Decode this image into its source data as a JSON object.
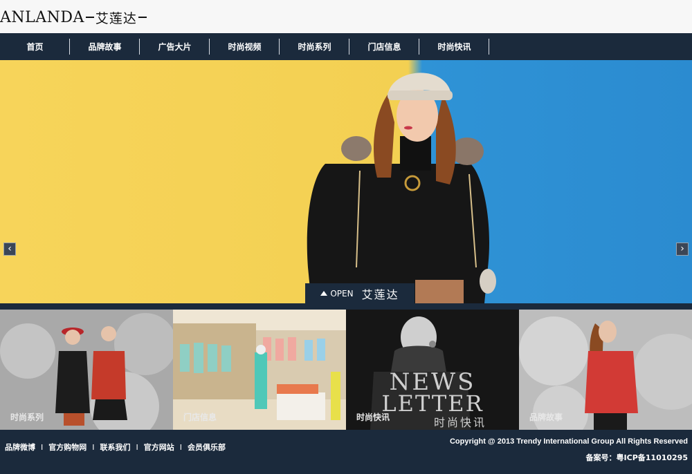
{
  "header": {
    "logo_latin": "ANLANDA",
    "logo_cn": "艾莲达"
  },
  "nav": {
    "items": [
      {
        "label": "首页"
      },
      {
        "label": "品牌故事"
      },
      {
        "label": "广告大片"
      },
      {
        "label": "时尚视频"
      },
      {
        "label": "时尚系列"
      },
      {
        "label": "门店信息"
      },
      {
        "label": "时尚快讯"
      }
    ]
  },
  "hero": {
    "arrow_left": "‹",
    "arrow_right": "›",
    "open_label": "OPEN",
    "open_brand": "艾莲达"
  },
  "tiles": [
    {
      "label": "时尚系列",
      "icon": "fashion-series-photo"
    },
    {
      "label": "门店信息",
      "icon": "store-info-photo"
    },
    {
      "label": "时尚快讯",
      "icon": "newsletter-photo",
      "overlay_top": "NEWS",
      "overlay_mid": "LETTER",
      "overlay_cn": "时尚快讯"
    },
    {
      "label": "品牌故事",
      "icon": "brand-story-photo"
    }
  ],
  "footer": {
    "links": [
      {
        "label": "品牌微博"
      },
      {
        "label": "官方购物网"
      },
      {
        "label": "联系我们"
      },
      {
        "label": "官方网站"
      },
      {
        "label": "会员俱乐部"
      }
    ],
    "separator": "I",
    "copyright": "Copyright @ 2013 Trendy International Group All Rights Reserved",
    "icp": "备案号：粤ICP备11010295"
  },
  "colors": {
    "navy": "#1b2a3c",
    "hero_yellow": "#f3d052",
    "hero_blue": "#2b8bd0"
  }
}
